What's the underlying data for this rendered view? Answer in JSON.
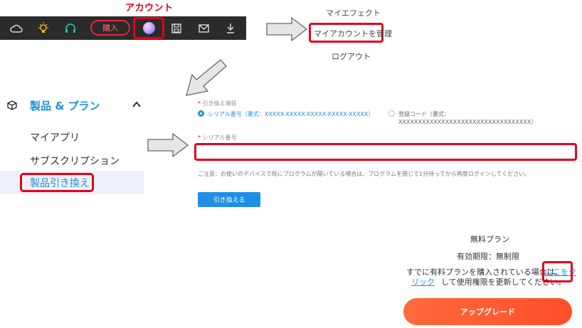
{
  "toolbar": {
    "account_label": "アカウント",
    "buy_label": "購入",
    "icons": [
      "cloud-icon",
      "bulb-icon",
      "headset-icon",
      "avatar-icon",
      "save-icon",
      "mail-icon",
      "download-icon"
    ]
  },
  "account_menu": {
    "items": [
      "マイエフェクト",
      "マイアカウントを管理",
      "ログアウト"
    ]
  },
  "sidebar": {
    "section_title": "製品 & プラン",
    "items": [
      "マイアプリ",
      "サブスクリプション",
      "製品引き換え"
    ]
  },
  "form": {
    "redeem_type_label": "引き換え項目",
    "option_serial": "シリアル番号（書式：XXXXX-XXXXX-XXXXX-XXXXX-XXXXX）",
    "option_register": "登録コード（書式：XXXXXXXXXXXXXXXXXXXXXXXXXXXXXXXXXX）",
    "serial_label": "シリアル番号",
    "note": "ご注意：お使いのデバイスで既にプログラムが開いている場合は、プログラムを閉じて1分待ってから再度ログインしてください。",
    "redeem_button": "引き換える"
  },
  "plan": {
    "name": "無料プラン",
    "expiry": "有効期限：無制限",
    "paid_text_1": "すでに有料プランを購入されている場合は、",
    "link_part1": "ここをク",
    "link_part2": "リック",
    "paid_text_2": "して使用権限を更新してください。",
    "upgrade_button": "アップグレード"
  },
  "colors": {
    "accent": "#1f8fe5",
    "highlight": "#e2001a",
    "upgrade": "#ff5a33",
    "toolbar_bg": "#2b2b2b"
  }
}
